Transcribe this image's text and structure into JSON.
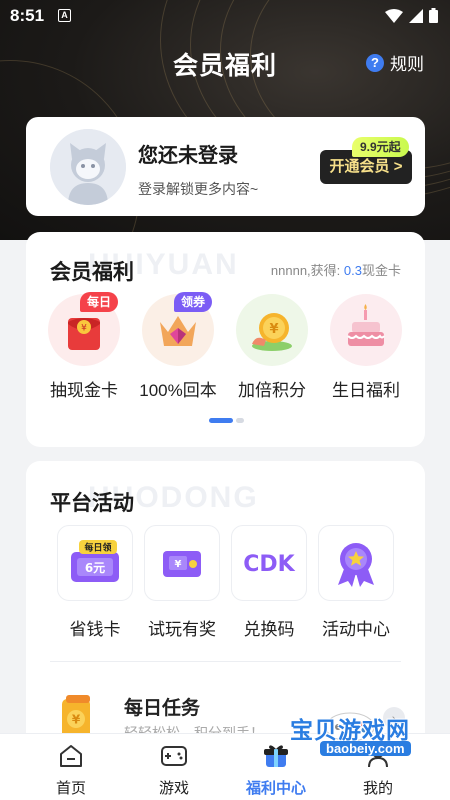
{
  "status_bar": {
    "time": "8:51",
    "notification_glyph": "A"
  },
  "header": {
    "title": "会员福利",
    "rules_label": "规则",
    "rules_icon": "question-circle-icon"
  },
  "login_card": {
    "title": "您还未登录",
    "subtitle": "登录解锁更多内容~",
    "vip_price_tag": "9.9元起",
    "vip_button": "开通会员 >"
  },
  "welfare": {
    "title": "会员福利",
    "bg_word": "HUIYUAN",
    "info_prefix": "nnnnn,获得: ",
    "info_amount": "0.3",
    "info_suffix": "现金卡",
    "items": [
      {
        "label": "抽现金卡",
        "badge": "每日",
        "badge_color": "#f5424a",
        "icon": "red-envelope-icon"
      },
      {
        "label": "100%回本",
        "badge": "领券",
        "badge_color": "#7b5cf5",
        "icon": "diamond-crown-icon"
      },
      {
        "label": "加倍积分",
        "badge": "",
        "badge_color": "",
        "icon": "gold-coin-icon"
      },
      {
        "label": "生日福利",
        "badge": "",
        "badge_color": "",
        "icon": "birthday-cake-icon"
      }
    ],
    "page_indicator": {
      "pages": 2,
      "current": 1
    }
  },
  "activities": {
    "title": "平台活动",
    "bg_word": "HUODONG",
    "items": [
      {
        "label": "省钱卡",
        "icon": "coupon-card-icon",
        "tag": "每日领",
        "amount": "6元"
      },
      {
        "label": "试玩有奖",
        "icon": "trial-ticket-icon"
      },
      {
        "label": "兑换码",
        "icon": "cdk-icon",
        "code": "CDK"
      },
      {
        "label": "活动中心",
        "icon": "star-badge-icon"
      }
    ],
    "daily_task": {
      "title": "每日任务",
      "subtitle": "轻轻松松，积分到手！",
      "icon": "task-coin-icon"
    }
  },
  "tabbar": {
    "tabs": [
      {
        "label": "首页",
        "icon": "home-icon",
        "active": false
      },
      {
        "label": "游戏",
        "icon": "gamepad-icon",
        "active": false
      },
      {
        "label": "福利中心",
        "icon": "gift-icon",
        "active": true
      },
      {
        "label": "我的",
        "icon": "user-icon",
        "active": false
      }
    ]
  },
  "watermark": {
    "text": "宝贝游戏网",
    "url": "baobeiy.com"
  },
  "colors": {
    "accent": "#3f7cf0",
    "vip_gold": "#f7e08a",
    "hero_dark": "#1c1a18"
  }
}
